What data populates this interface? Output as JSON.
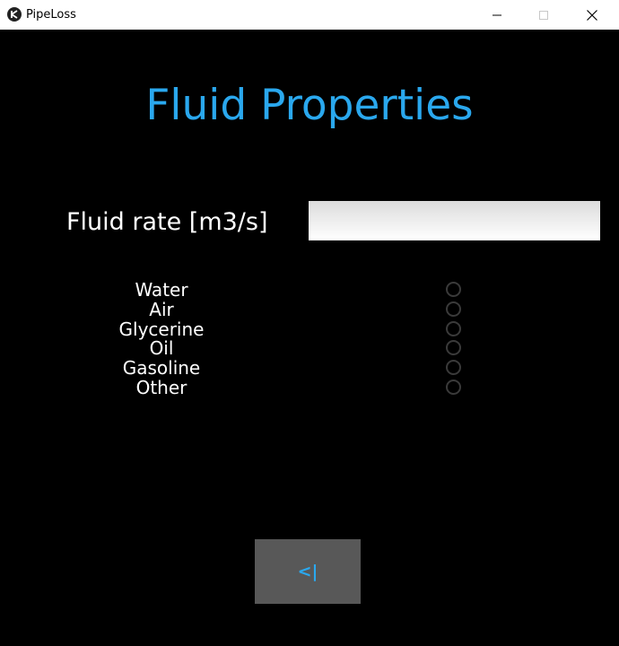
{
  "window": {
    "title": "PipeLoss",
    "controls": [
      "minimize-icon",
      "maximize-icon",
      "close-icon"
    ]
  },
  "page": {
    "heading": "Fluid Properties",
    "heading_color": "#2aa8ee"
  },
  "fluid_rate": {
    "label": "Fluid rate [m3/s]",
    "value": "",
    "placeholder": ""
  },
  "fluids": {
    "items": [
      {
        "label": "Water",
        "selected": false
      },
      {
        "label": "Air",
        "selected": false
      },
      {
        "label": "Glycerine",
        "selected": false
      },
      {
        "label": "Oil",
        "selected": false
      },
      {
        "label": "Gasoline",
        "selected": false
      },
      {
        "label": "Other",
        "selected": false
      }
    ]
  },
  "back_button": {
    "label": "<|",
    "background": "#585858"
  }
}
